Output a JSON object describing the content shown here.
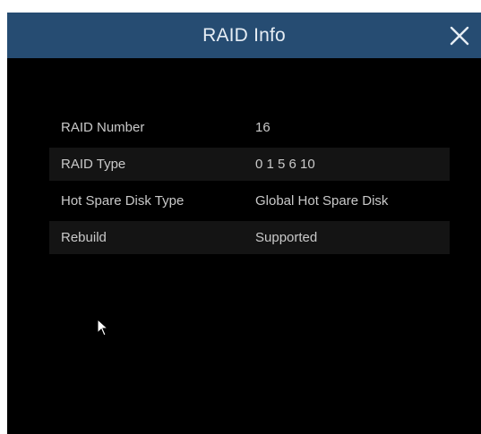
{
  "dialog": {
    "title": "RAID Info",
    "close_icon": "close-icon"
  },
  "raid_info": {
    "rows": [
      {
        "label": "RAID Number",
        "value": "16"
      },
      {
        "label": "RAID Type",
        "value": "0 1 5 6 10"
      },
      {
        "label": "Hot Spare Disk Type",
        "value": "Global Hot Spare Disk"
      },
      {
        "label": "Rebuild",
        "value": "Supported"
      }
    ]
  },
  "colors": {
    "titlebar": "#264c72",
    "background": "#000000",
    "row_shade": "#141414",
    "text": "#c9c9c9"
  }
}
